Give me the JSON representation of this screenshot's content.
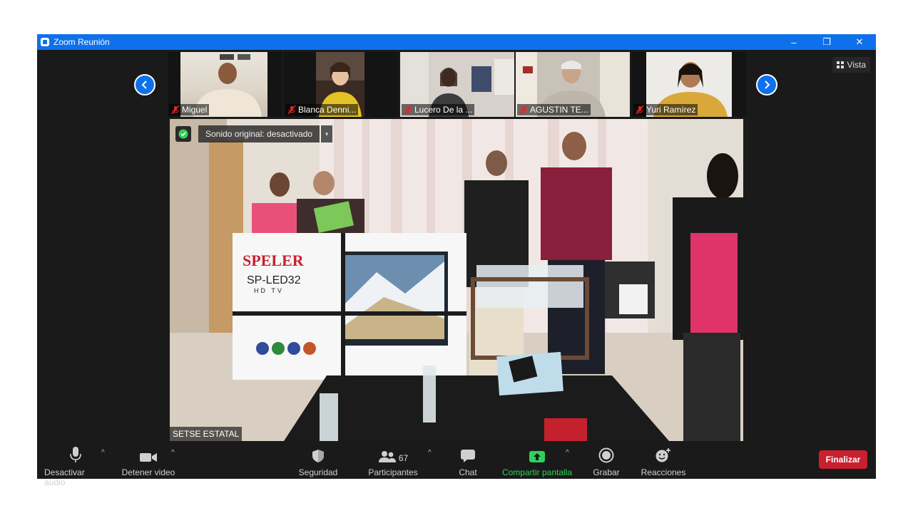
{
  "window": {
    "title": "Zoom Reunión",
    "controls": [
      "–",
      "❐",
      "✕"
    ]
  },
  "filmstrip": {
    "participants": [
      {
        "name": "Miguel",
        "muted": true
      },
      {
        "name": "Blanca Denni...",
        "muted": true
      },
      {
        "name": "Lucero De la ...",
        "muted": true
      },
      {
        "name": "AGUSTIN TE...",
        "muted": true
      },
      {
        "name": "Yuri Ramírez",
        "muted": true
      }
    ],
    "prev_icon": "chevron-left-icon",
    "next_icon": "chevron-right-icon"
  },
  "view_button": {
    "label": "Vista",
    "icon": "grid-icon"
  },
  "main_video": {
    "sound_status": "Sonido original: desactivado",
    "speaker": "SETSE ESTATAL",
    "box_brand": "SPELER",
    "box_model": "SP-LED32",
    "box_sub": "HD TV"
  },
  "toolbar": {
    "mute_audio": "Desactivar audio",
    "stop_video": "Detener video",
    "security": "Seguridad",
    "participants": "Participantes",
    "participants_count": "67",
    "chat": "Chat",
    "share_screen": "Compartir pantalla",
    "record": "Grabar",
    "reactions": "Reacciones",
    "end": "Finalizar"
  },
  "colors": {
    "accent": "#0e71eb",
    "share_green": "#30d158",
    "end_red": "#c8202f",
    "toolbar_bg": "#1a1a1a"
  }
}
